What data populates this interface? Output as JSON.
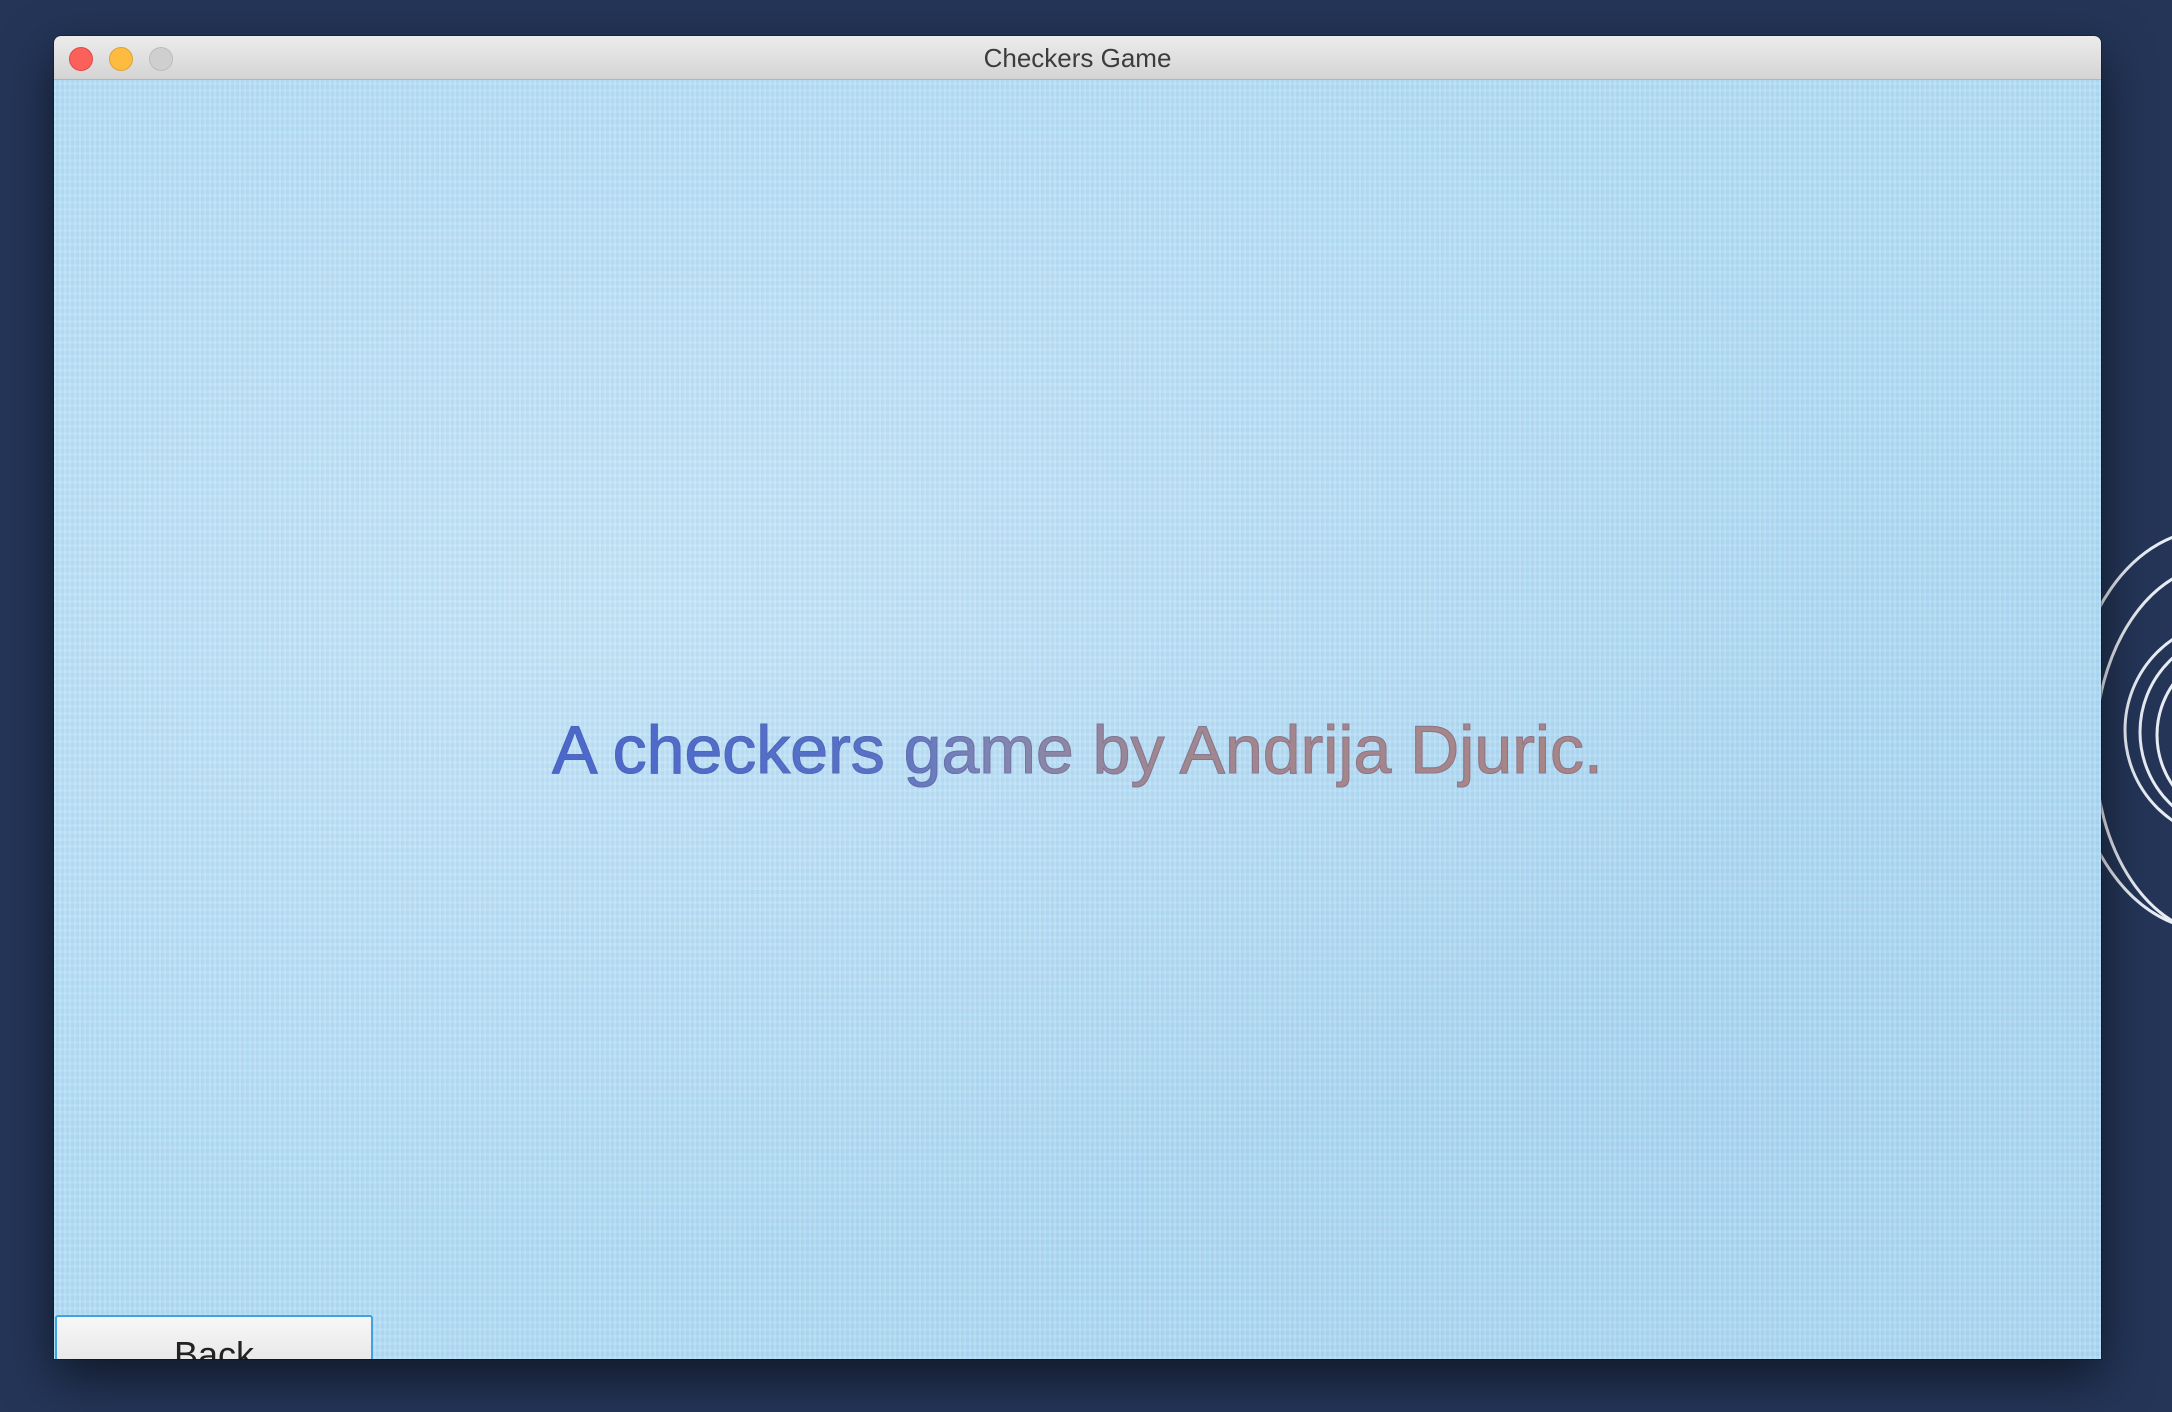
{
  "window": {
    "title": "Checkers Game"
  },
  "traffic_lights": {
    "close_color": "#fc605b",
    "minimize_color": "#fdbc40",
    "zoom_color": "#cfcfcf"
  },
  "content": {
    "credits_text": "A checkers game by Andrija Djuric.",
    "back_label": "Back"
  },
  "colors": {
    "desktop_background": "#243558",
    "content_background": "#b3dcf4",
    "text_gradient_start": "#4b68cc",
    "text_gradient_end": "#a98585",
    "button_focus_border": "#3fa2e3"
  }
}
